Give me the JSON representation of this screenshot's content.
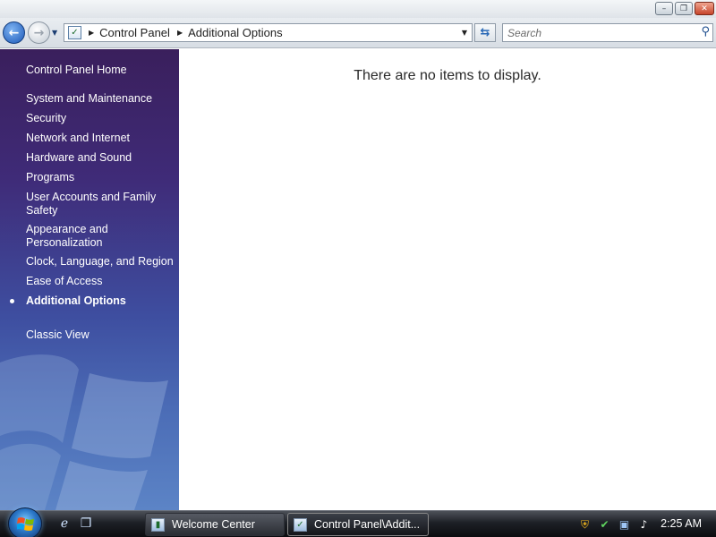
{
  "window": {
    "minimize_glyph": "–",
    "restore_glyph": "❐",
    "close_glyph": "✕"
  },
  "address_bar": {
    "back_glyph": "←",
    "forward_glyph": "→",
    "breadcrumbs": [
      "Control Panel",
      "Additional Options"
    ],
    "search_placeholder": "Search"
  },
  "sidebar": {
    "home": "Control Panel Home",
    "categories": [
      "System and Maintenance",
      "Security",
      "Network and Internet",
      "Hardware and Sound",
      "Programs",
      "User Accounts and Family Safety",
      "Appearance and Personalization",
      "Clock, Language, and Region",
      "Ease of Access",
      "Additional Options"
    ],
    "active_category": "Additional Options",
    "classic_view": "Classic View"
  },
  "content": {
    "empty_message": "There are no items to display."
  },
  "taskbar": {
    "buttons": [
      "Welcome Center",
      "Control Panel\\Addit..."
    ],
    "active_button": "Control Panel\\Addit...",
    "clock": "2:25 AM"
  },
  "icons": {
    "back": "back-arrow-icon",
    "forward": "forward-arrow-icon",
    "control_panel": "control-panel-icon",
    "refresh": "refresh-icon",
    "search": "magnifier-icon",
    "start": "windows-start-orb-icon",
    "ie": "internet-explorer-icon",
    "switch_windows": "switch-windows-icon",
    "security_shield": "shield-icon",
    "network": "network-icon",
    "volume": "speaker-icon"
  }
}
